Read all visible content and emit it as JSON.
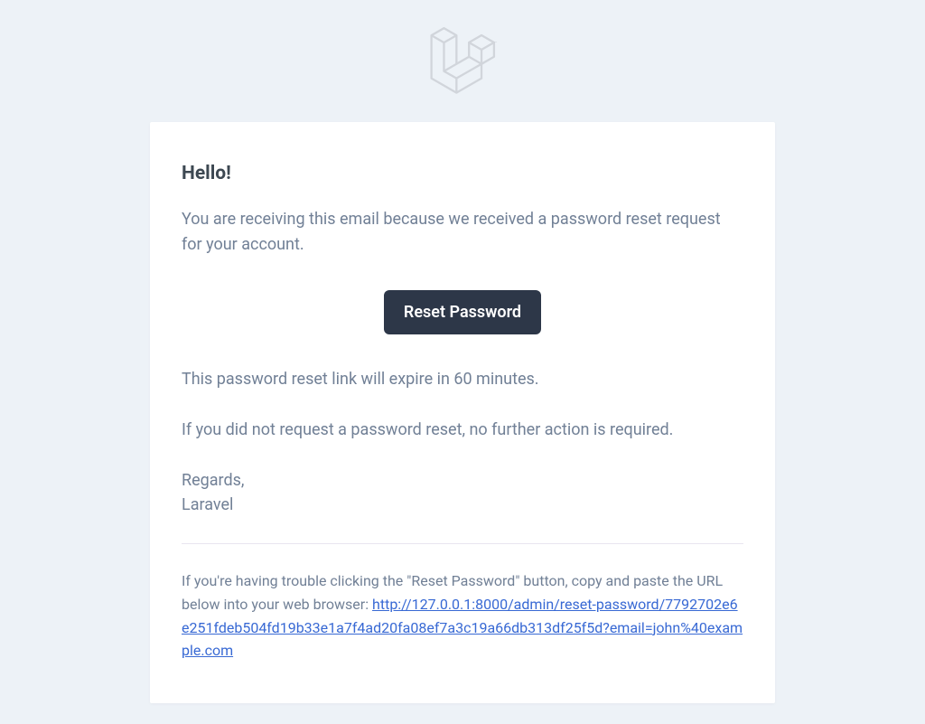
{
  "header": {
    "logo_alt": "Laravel Logo"
  },
  "email": {
    "greeting": "Hello!",
    "intro": "You are receiving this email because we received a password reset request for your account.",
    "button_label": "Reset Password",
    "expire_notice": "This password reset link will expire in 60 minutes.",
    "no_action": "If you did not request a password reset, no further action is required.",
    "signoff_regards": "Regards,",
    "signoff_brand": "Laravel",
    "subcopy_prefix": "If you're having trouble clicking the \"Reset Password\" button, copy and paste the URL below into your web browser: ",
    "subcopy_url": "http://127.0.0.1:8000/admin/reset-password/7792702e6e251fdeb504fd19b33e1a7f4ad20fa08ef7a3c19a66db313df25f5d?email=john%40example.com"
  }
}
